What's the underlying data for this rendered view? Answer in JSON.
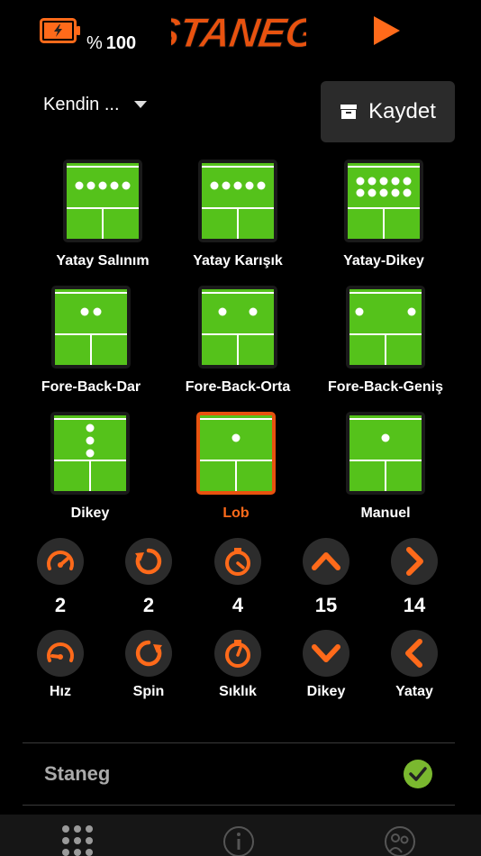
{
  "header": {
    "battery_percent_sign": "%",
    "battery_value": "100",
    "logo_text": "STANEG",
    "play_icon": "play-icon",
    "battery_icon": "battery-charging-icon"
  },
  "profile_select": {
    "value": "Kendin ..."
  },
  "save_button": {
    "label": "Kaydet",
    "icon": "archive-icon"
  },
  "modes": [
    {
      "label": "Yatay Salınım",
      "selected": false
    },
    {
      "label": "Yatay Karışık",
      "selected": false
    },
    {
      "label": "Yatay-Dikey",
      "selected": false
    },
    {
      "label": "Fore-Back-Dar",
      "selected": false
    },
    {
      "label": "Fore-Back-Orta",
      "selected": false
    },
    {
      "label": "Fore-Back-Geniş",
      "selected": false
    },
    {
      "label": "Dikey",
      "selected": false
    },
    {
      "label": "Lob",
      "selected": true
    },
    {
      "label": "Manuel",
      "selected": false
    }
  ],
  "controls": [
    {
      "label": "Hız",
      "value": "2",
      "icon_up": "speedometer-up-icon",
      "icon_down": "speedometer-down-icon"
    },
    {
      "label": "Spin",
      "value": "2",
      "icon_up": "rotate-cw-icon",
      "icon_down": "rotate-ccw-icon"
    },
    {
      "label": "Sıklık",
      "value": "4",
      "icon_up": "stopwatch-up-icon",
      "icon_down": "stopwatch-down-icon"
    },
    {
      "label": "Dikey",
      "value": "15",
      "icon_up": "chevron-up-icon",
      "icon_down": "chevron-down-icon"
    },
    {
      "label": "Yatay",
      "value": "14",
      "icon_up": "chevron-right-icon",
      "icon_down": "chevron-left-icon"
    }
  ],
  "device": {
    "name": "Staneg",
    "connected": true
  },
  "tabs": [
    {
      "icon": "grid-icon",
      "active": true
    },
    {
      "icon": "info-icon",
      "active": false
    },
    {
      "icon": "people-icon",
      "active": false
    }
  ],
  "colors": {
    "accent": "#ff6a1a",
    "court_green": "#55c21b",
    "check_green": "#7ab82f"
  }
}
